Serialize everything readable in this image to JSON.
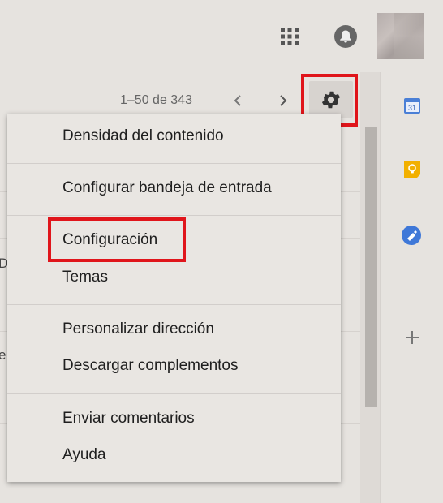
{
  "header": {
    "apps_icon": "apps-grid-icon",
    "notifications_icon": "bell-icon",
    "avatar": "account-avatar"
  },
  "toolbar": {
    "pager_text": "1–50 de 343",
    "prev_icon": "chevron-left-icon",
    "next_icon": "chevron-right-icon",
    "settings_icon": "gear-icon"
  },
  "list_edge": {
    "letter_1": "D",
    "letter_2": "e"
  },
  "menu": {
    "items": [
      {
        "label": "Densidad del contenido"
      },
      {
        "label": "Configurar bandeja de entrada"
      },
      {
        "label": "Configuración"
      },
      {
        "label": "Temas"
      },
      {
        "label": "Personalizar dirección"
      },
      {
        "label": "Descargar complementos"
      },
      {
        "label": "Enviar comentarios"
      },
      {
        "label": "Ayuda"
      }
    ]
  },
  "side_panel": {
    "calendar_icon": "calendar-icon",
    "calendar_day": "31",
    "keep_icon": "keep-bulb-icon",
    "tasks_icon": "tasks-check-icon",
    "add_icon": "plus-icon"
  },
  "colors": {
    "highlight": "#e0151b",
    "calendar_blue": "#4a7fd6",
    "keep_yellow": "#f2b000",
    "tasks_blue": "#3f78d8"
  }
}
